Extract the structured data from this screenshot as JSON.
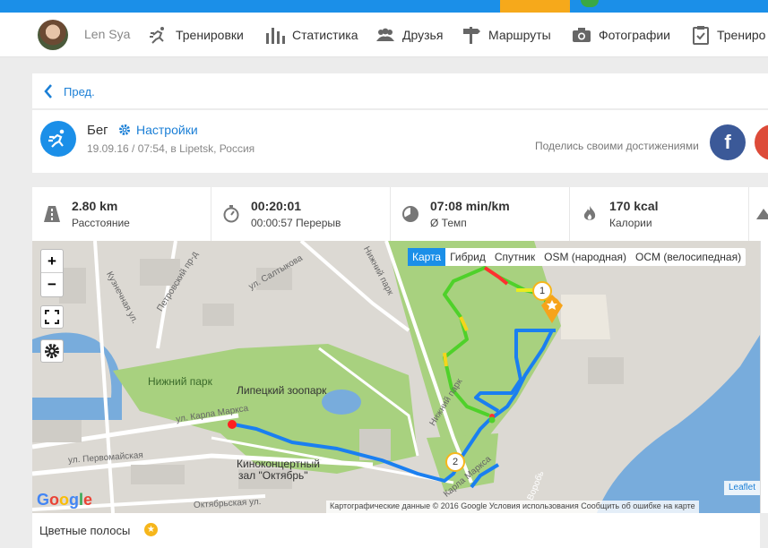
{
  "user": {
    "name": "Len Sya"
  },
  "nav": [
    {
      "label": "Тренировки",
      "icon": "runner-icon"
    },
    {
      "label": "Статистика",
      "icon": "bar-chart-icon"
    },
    {
      "label": "Друзья",
      "icon": "friends-icon"
    },
    {
      "label": "Маршруты",
      "icon": "signpost-icon"
    },
    {
      "label": "Фотографии",
      "icon": "camera-icon"
    },
    {
      "label": "Трениро",
      "icon": "clipboard-icon"
    }
  ],
  "back": {
    "label": "Пред."
  },
  "activity": {
    "title": "Бег",
    "settings_label": "Настройки",
    "subtitle": "19.09.16 / 07:54, в Lipetsk, Россия",
    "share_text": "Поделись своими достижениями"
  },
  "stats": [
    {
      "value": "2.80 km",
      "label": "Расстояние",
      "icon": "road-icon"
    },
    {
      "value": "00:20:01",
      "label": "00:00:57 Перерыв",
      "icon": "stopwatch-icon"
    },
    {
      "value": "07:08 min/km",
      "label": "Ø Темп",
      "icon": "pace-icon"
    },
    {
      "value": "170 kcal",
      "label": "Калории",
      "icon": "flame-icon"
    }
  ],
  "map": {
    "zoom_in": "+",
    "zoom_out": "−",
    "layers": [
      "Карта",
      "Гибрид",
      "Спутник",
      "OSM (народная)",
      "OCM (велосипедная)"
    ],
    "active_layer": "Карта",
    "labels": {
      "park": "Нижний парк",
      "zoo": "Липецкий зоопарк",
      "cinema1": "Киноконцертный",
      "cinema2": "зал \"Октябрь\"",
      "karla_marksa": "ул. Карла Маркса",
      "pervomayskaya": "ул. Первомайская",
      "oktyabrskaya": "Октябрьская ул.",
      "petrovsky": "Петровский пр-д",
      "saltykova": "ул. Салтыкова",
      "kuznechnaya": "Кузнечная ул.",
      "nizhny_park_road": "Нижний парк",
      "nizhny_park_road2": "Нижний парк",
      "vorobyov": "Воробь",
      "karla_marksa2": "Карла Маркса"
    },
    "markers": [
      "1",
      "2"
    ],
    "attribution": "Картографические данные © 2016 Google   Условия использования   Сообщить об ошибке на карте",
    "leaflet": "Leaflet",
    "google": "Google"
  },
  "footer": {
    "label": "Цветные полосы"
  },
  "colors": {
    "accent": "#1b8fe8",
    "facebook": "#3b5998",
    "water": "#6aa6d8",
    "park": "#9fcf7a"
  }
}
